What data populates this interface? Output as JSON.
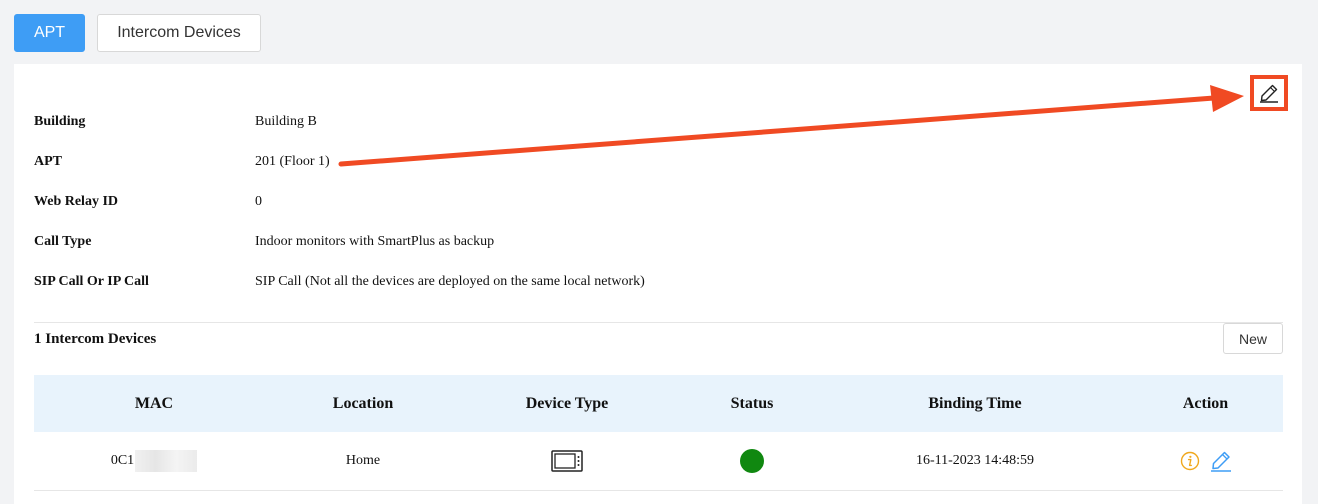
{
  "tabs": [
    {
      "label": "APT"
    },
    {
      "label": "Intercom Devices"
    }
  ],
  "info": {
    "building_label": "Building",
    "building_value": "Building B",
    "apt_label": "APT",
    "apt_value": "201 (Floor 1)",
    "relay_label": "Web Relay ID",
    "relay_value": "0",
    "calltype_label": "Call Type",
    "calltype_value": "Indoor monitors with SmartPlus as backup",
    "sip_label": "SIP Call Or IP Call",
    "sip_value": "SIP Call (Not all the devices are deployed on the same local network)"
  },
  "devices": {
    "title": "1 Intercom Devices",
    "new_label": "New",
    "columns": [
      "MAC",
      "Location",
      "Device Type",
      "Status",
      "Binding Time",
      "Action"
    ],
    "rows": [
      {
        "mac": "0C1",
        "location": "Home",
        "device_type_icon": "indoor-monitor-icon",
        "status_color": "#108810",
        "binding_time": "16-11-2023 14:48:59"
      }
    ]
  },
  "colors": {
    "accent": "#3e9df5",
    "annotation": "#f04a23",
    "status_online": "#108810",
    "info_icon": "#f0a81e"
  }
}
